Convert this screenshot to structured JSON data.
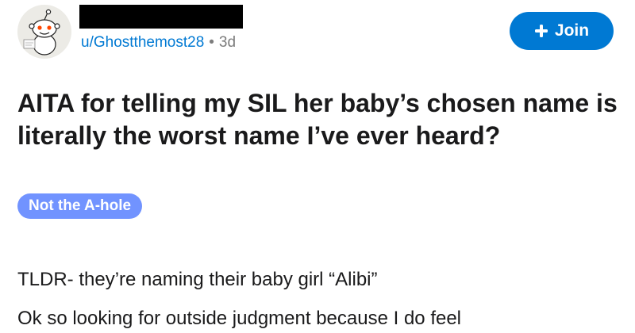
{
  "post_header": {
    "username": "u/Ghostthemost28",
    "separator": "•",
    "time": "3d",
    "join_label": "Join"
  },
  "post": {
    "title": "AITA for telling my SIL her baby’s chosen name is literally the worst name I’ve ever heard?",
    "flair": "Not the A-hole",
    "body": [
      "TLDR- they’re naming their baby girl “Alibi”",
      "Ok so looking for outside judgment because I do feel"
    ]
  },
  "colors": {
    "accent": "#0079d3",
    "flair_bg": "#7193ff",
    "text": "#1a1a1b",
    "meta": "#7c7c7c"
  },
  "icons": {
    "avatar": "snoo-avatar",
    "join": "plus-icon"
  }
}
